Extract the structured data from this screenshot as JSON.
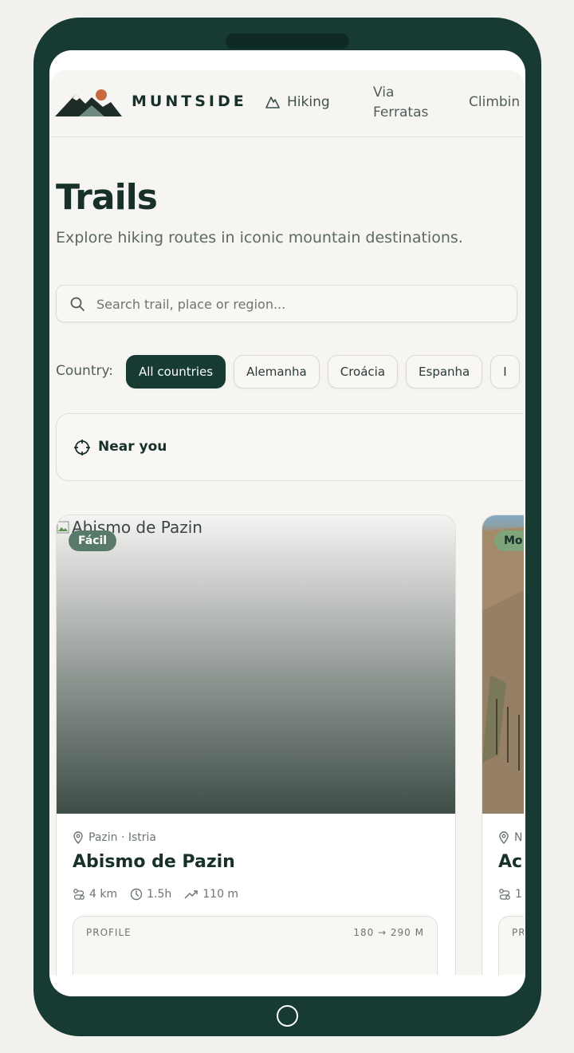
{
  "header": {
    "brand": "MUNTSIDE",
    "nav": {
      "hiking": "Hiking",
      "via_line1": "Via",
      "via_line2": "Ferratas",
      "climbing": "Climbin"
    }
  },
  "page": {
    "title": "Trails",
    "subtitle": "Explore hiking routes in iconic mountain destinations."
  },
  "search": {
    "placeholder": "Search trail, place or region..."
  },
  "filters": {
    "country_label": "Country:",
    "chips": [
      "All countries",
      "Alemanha",
      "Croácia",
      "Espanha",
      "I"
    ]
  },
  "near_you": {
    "label": "Near you"
  },
  "trails": [
    {
      "image_alt": "Abismo de Pazin",
      "difficulty": "Fácil",
      "location": "Pazin · Istria",
      "name": "Abismo de Pazin",
      "distance": "4 km",
      "duration": "1.5h",
      "elevation_gain": "110 m",
      "profile_label": "PROFILE",
      "profile_range": "180 → 290 M"
    },
    {
      "difficulty": "Mo",
      "location": "N",
      "name": "Ac",
      "distance": "1",
      "profile_label": "PR"
    }
  ],
  "colors": {
    "frame": "#173b33",
    "accent": "#17302a",
    "chip_active": "#173b33",
    "badge_easy": "#5a7a69",
    "badge_moderate": "#7fa37a",
    "logo_sun": "#c9693f"
  }
}
